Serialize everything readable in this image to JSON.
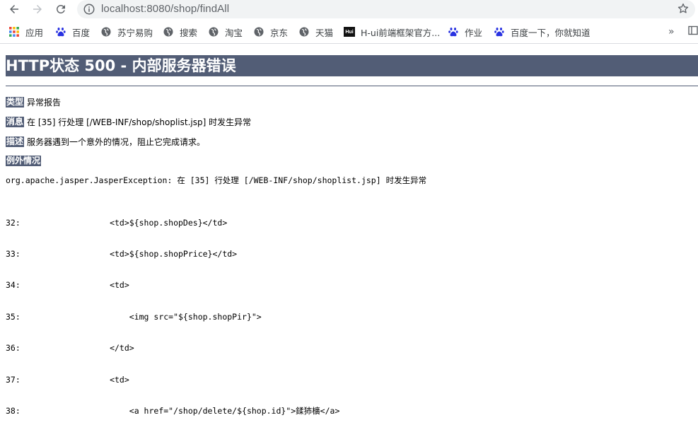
{
  "browser": {
    "url": "localhost:8080/shop/findAll",
    "bookmarks": [
      {
        "label": "应用",
        "icon": "apps-grid-icon"
      },
      {
        "label": "百度",
        "icon": "baidu-paw-icon"
      },
      {
        "label": "苏宁易购",
        "icon": "globe-icon"
      },
      {
        "label": "搜索",
        "icon": "globe-icon"
      },
      {
        "label": "淘宝",
        "icon": "globe-icon"
      },
      {
        "label": "京东",
        "icon": "globe-icon"
      },
      {
        "label": "天猫",
        "icon": "globe-icon"
      },
      {
        "label": "H-ui前端框架官方...",
        "icon": "hui-logo-icon",
        "icon_text": "Hui"
      },
      {
        "label": "作业",
        "icon": "baidu-paw-icon"
      },
      {
        "label": "百度一下，你就知道",
        "icon": "baidu-paw-icon"
      }
    ],
    "more_label": "»"
  },
  "error": {
    "title": "HTTP状态 500 - 内部服务器错误",
    "type_label": "类型",
    "type_value": "异常报告",
    "message_label": "消息",
    "message_value": "在 [35] 行处理 [/WEB-INF/shop/shoplist.jsp] 时发生异常",
    "description_label": "描述",
    "description_value": "服务器遇到一个意外的情况，阻止它完成请求。",
    "exception_label": "例外情况",
    "exception_line": "org.apache.jasper.JasperException: 在 [35] 行处理 [/WEB-INF/shop/shoplist.jsp] 时发生异常",
    "code_lines": [
      {
        "num": "32:",
        "code": "            <td>${shop.shopDes}</td>"
      },
      {
        "num": "33:",
        "code": "            <td>${shop.shopPrice}</td>"
      },
      {
        "num": "34:",
        "code": "            <td>"
      },
      {
        "num": "35:",
        "code": "                <img src=\"${shop.shopPir}\">"
      },
      {
        "num": "36:",
        "code": "            </td>"
      },
      {
        "num": "37:",
        "code": "            <td>"
      },
      {
        "num": "38:",
        "code": "                <a href=\"/shop/delete/${shop.id}\">鍒犻櫎</a>"
      }
    ]
  },
  "colors": {
    "header_bg": "#525d76",
    "omnibox_bg": "#f1f3f4"
  }
}
